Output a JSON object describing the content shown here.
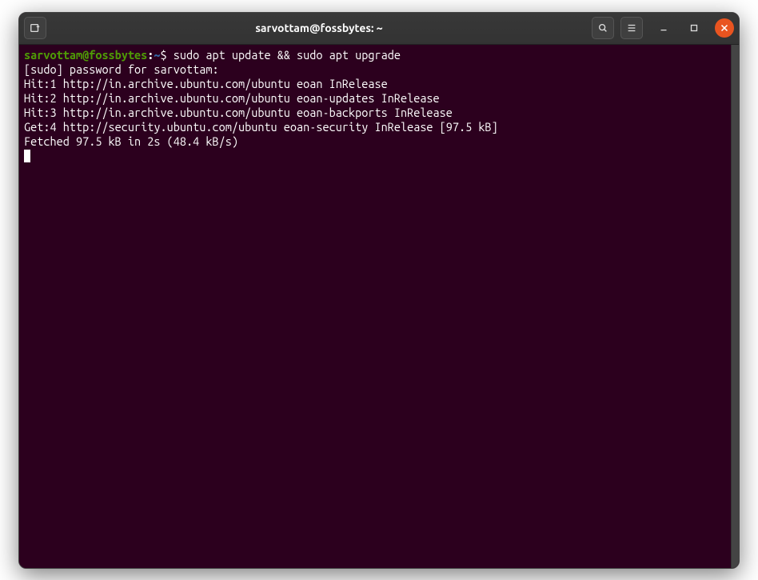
{
  "titlebar": {
    "title": "sarvottam@fossbytes: ~"
  },
  "prompt": {
    "user_host": "sarvottam@fossbytes",
    "colon": ":",
    "path": "~",
    "dollar": "$ "
  },
  "command": "sudo apt update && sudo apt upgrade",
  "output": {
    "line1": "[sudo] password for sarvottam:",
    "line2": "Hit:1 http://in.archive.ubuntu.com/ubuntu eoan InRelease",
    "line3": "Hit:2 http://in.archive.ubuntu.com/ubuntu eoan-updates InRelease",
    "line4": "Hit:3 http://in.archive.ubuntu.com/ubuntu eoan-backports InRelease",
    "line5": "Get:4 http://security.ubuntu.com/ubuntu eoan-security InRelease [97.5 kB]",
    "line6": "Fetched 97.5 kB in 2s (48.4 kB/s)"
  }
}
